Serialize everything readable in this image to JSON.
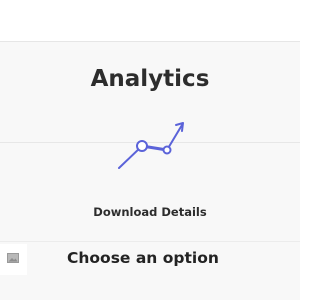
{
  "panel": {
    "title": "Analytics",
    "download_label": "Download Details",
    "icon": "analytics-trend-icon",
    "accent_color": "#5b63d9"
  },
  "option": {
    "label": "Choose an option",
    "icon": "image-placeholder-icon"
  }
}
